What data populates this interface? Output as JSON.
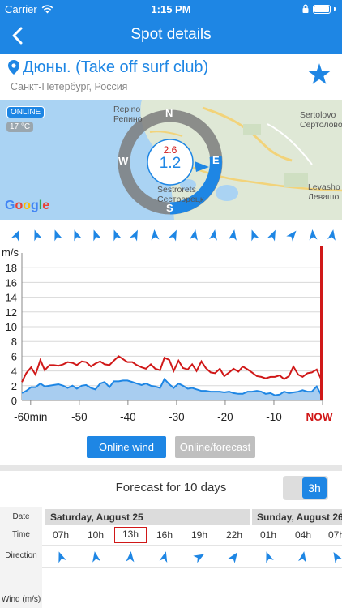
{
  "status": {
    "carrier": "Carrier",
    "time": "1:15 PM"
  },
  "nav": {
    "title": "Spot details"
  },
  "spot": {
    "name": "Дюны. (Take off surf club)",
    "location": "Санкт-Петербург, Россия"
  },
  "map": {
    "online_badge": "ONLINE",
    "temperature": "17 °C",
    "labels": {
      "repino_en": "Repino",
      "repino_ru": "Репино",
      "sertolovo_en": "Sertolovo",
      "sertolovo_ru": "Сертолово",
      "levashovo_en": "Levasho",
      "levashovo_ru": "Левашо",
      "sestroretsk_en": "Sestrorets",
      "sestroretsk_ru": "Сестрорецк"
    },
    "gust": "2.6",
    "speed": "1.2",
    "compass": {
      "n": "N",
      "s": "S",
      "w": "W",
      "e": "E"
    },
    "google": {
      "g1": "G",
      "o1": "o",
      "o2": "o",
      "g2": "g",
      "l": "l",
      "e": "e"
    }
  },
  "chart_data": {
    "type": "line",
    "xlabel": "",
    "ylabel": "m/s",
    "ylim": [
      0,
      20
    ],
    "yticks": [
      "0",
      "2",
      "4",
      "6",
      "8",
      "10",
      "12",
      "14",
      "16",
      "18"
    ],
    "xticks": [
      "-60min",
      "-50",
      "-40",
      "-30",
      "-20",
      "-10",
      "NOW"
    ],
    "xtick_values": [
      -60,
      -50,
      -40,
      -30,
      -20,
      -10,
      0
    ],
    "xlim": [
      -61.8,
      0
    ],
    "series": [
      {
        "color": "#D01818",
        "x": [
          -61.8,
          -60.9,
          -59.9,
          -59,
          -58,
          -57.1,
          -56.1,
          -55.2,
          -54.3,
          -53.3,
          -52.4,
          -51.4,
          -50.5,
          -49.5,
          -48.6,
          -47.6,
          -46.7,
          -45.7,
          -44.8,
          -43.8,
          -42.9,
          -41.9,
          -41,
          -40.1,
          -39.1,
          -38.2,
          -37.2,
          -36.3,
          -35.3,
          -34.4,
          -33.4,
          -32.5,
          -31.5,
          -30.6,
          -29.6,
          -28.7,
          -27.7,
          -26.8,
          -25.9,
          -24.9,
          -24,
          -23,
          -22.1,
          -21.1,
          -20.2,
          -19.2,
          -18.3,
          -17.3,
          -16.4,
          -15.4,
          -14.5,
          -13.5,
          -12.6,
          -11.7,
          -10.7,
          -9.8,
          -8.8,
          -7.9,
          -6.9,
          -6,
          -5,
          -4.1,
          -3.1,
          -2.2,
          -1.2,
          -0.3
        ],
        "y": [
          2.5,
          3.7,
          4.5,
          3.5,
          5.5,
          4.1,
          4.8,
          4.8,
          4.7,
          4.9,
          5.2,
          5.1,
          4.8,
          5.3,
          5.2,
          4.6,
          5,
          5.3,
          4.9,
          4.8,
          5.4,
          6,
          5.6,
          5.2,
          5.2,
          4.8,
          4.5,
          4.3,
          4.9,
          4.3,
          4.1,
          5.8,
          5.5,
          4,
          5.4,
          4.4,
          4.2,
          4.9,
          4,
          5.3,
          4.4,
          3.8,
          3.7,
          4.3,
          3.3,
          3.8,
          4.3,
          3.9,
          4.6,
          4.2,
          3.8,
          3.3,
          3.2,
          3,
          3.2,
          3.2,
          3.4,
          2.9,
          3.3,
          4.6,
          3.5,
          3.2,
          3.7,
          3.8,
          4.2,
          2.9
        ]
      },
      {
        "color": "#1E86E4",
        "x": [
          -61.8,
          -60.9,
          -59.9,
          -59,
          -58,
          -57.1,
          -56.1,
          -55.2,
          -54.3,
          -53.3,
          -52.4,
          -51.4,
          -50.5,
          -49.5,
          -48.6,
          -47.6,
          -46.7,
          -45.7,
          -44.8,
          -43.8,
          -42.9,
          -41.9,
          -41,
          -40.1,
          -39.1,
          -38.2,
          -37.2,
          -36.3,
          -35.3,
          -34.4,
          -33.4,
          -32.5,
          -31.5,
          -30.6,
          -29.6,
          -28.7,
          -27.7,
          -26.8,
          -25.9,
          -24.9,
          -24,
          -23,
          -22.1,
          -21.1,
          -20.2,
          -19.2,
          -18.3,
          -17.3,
          -16.4,
          -15.4,
          -14.5,
          -13.5,
          -12.6,
          -11.7,
          -10.7,
          -9.8,
          -8.8,
          -7.9,
          -6.9,
          -6,
          -5,
          -4.1,
          -3.1,
          -2.2,
          -1.2,
          -0.3
        ],
        "y": [
          1,
          1.3,
          1.8,
          1.8,
          2.3,
          1.9,
          2,
          2.1,
          2.2,
          2,
          1.7,
          2,
          1.6,
          2,
          2.1,
          1.7,
          1.5,
          2.3,
          2.5,
          1.8,
          2.6,
          2.6,
          2.7,
          2.7,
          2.5,
          2.3,
          2.1,
          2.3,
          2,
          1.9,
          1.7,
          2.9,
          2.2,
          1.7,
          2.3,
          2,
          1.6,
          1.7,
          1.5,
          1.3,
          1.3,
          1.2,
          1.2,
          1.2,
          1.1,
          1.2,
          1,
          0.9,
          0.9,
          1.2,
          1.2,
          1.3,
          1.2,
          0.9,
          1,
          0.7,
          0.8,
          1.2,
          1,
          1.1,
          1.2,
          1.4,
          1.2,
          1.2,
          1.9,
          0.8
        ]
      }
    ],
    "now_marker": 0,
    "grid": true
  },
  "chart_top_arrows": [
    25,
    340,
    340,
    340,
    340,
    340,
    25,
    355,
    25,
    10,
    10,
    10,
    340,
    25,
    40,
    355,
    10
  ],
  "buttons": {
    "online_wind": "Online wind",
    "online_forecast": "Online/forecast"
  },
  "forecast": {
    "title": "Forecast for 10 days",
    "interval": "3h",
    "labels": {
      "date": "Date",
      "time": "Time",
      "direction": "Direction",
      "wind": "Wind (m/s)"
    },
    "days": [
      "Saturday, August 25",
      "Sunday, August 26"
    ],
    "hours": [
      "07h",
      "10h",
      "13h",
      "16h",
      "19h",
      "22h",
      "01h",
      "04h",
      "07h"
    ],
    "selected_hour_index": 2,
    "directions": [
      340,
      350,
      5,
      15,
      60,
      35,
      340,
      10,
      330
    ]
  }
}
